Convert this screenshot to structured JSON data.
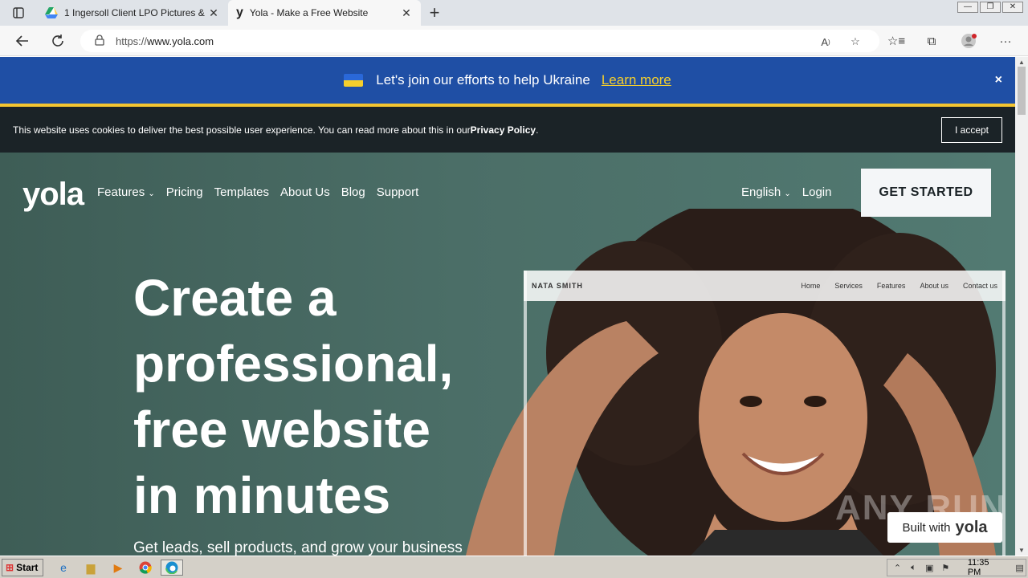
{
  "browser": {
    "tabs": [
      {
        "title": "1 Ingersoll Client LPO Pictures &",
        "icon": "google-drive-icon"
      },
      {
        "title": "Yola - Make a Free Website",
        "icon": "yola-icon"
      }
    ],
    "url_prefix": "https://",
    "url_host": "www.yola.com"
  },
  "banner": {
    "text": "Let's join our efforts to help Ukraine",
    "link": "Learn more",
    "close": "×"
  },
  "cookie": {
    "text": "This website uses cookies to deliver the best possible user experience. You can read more about this in our ",
    "policy": "Privacy Policy",
    "period": ".",
    "accept": "I accept"
  },
  "nav": {
    "logo": "yola",
    "items": [
      "Features",
      "Pricing",
      "Templates",
      "About Us",
      "Blog",
      "Support"
    ],
    "language": "English",
    "login": "Login",
    "cta": "GET STARTED"
  },
  "hero": {
    "headline_lines": [
      "Create a",
      "professional,",
      "free website",
      "in minutes"
    ],
    "subline": "Get leads, sell products, and grow your business"
  },
  "mockup": {
    "brand": "NATA SMITH",
    "nav": [
      "Home",
      "Services",
      "Features",
      "About us",
      "Contact us"
    ]
  },
  "badge": {
    "text": "Built with",
    "logo": "yola"
  },
  "watermark": "ANY RUN",
  "taskbar": {
    "start": "Start",
    "time": "11:35 PM"
  }
}
